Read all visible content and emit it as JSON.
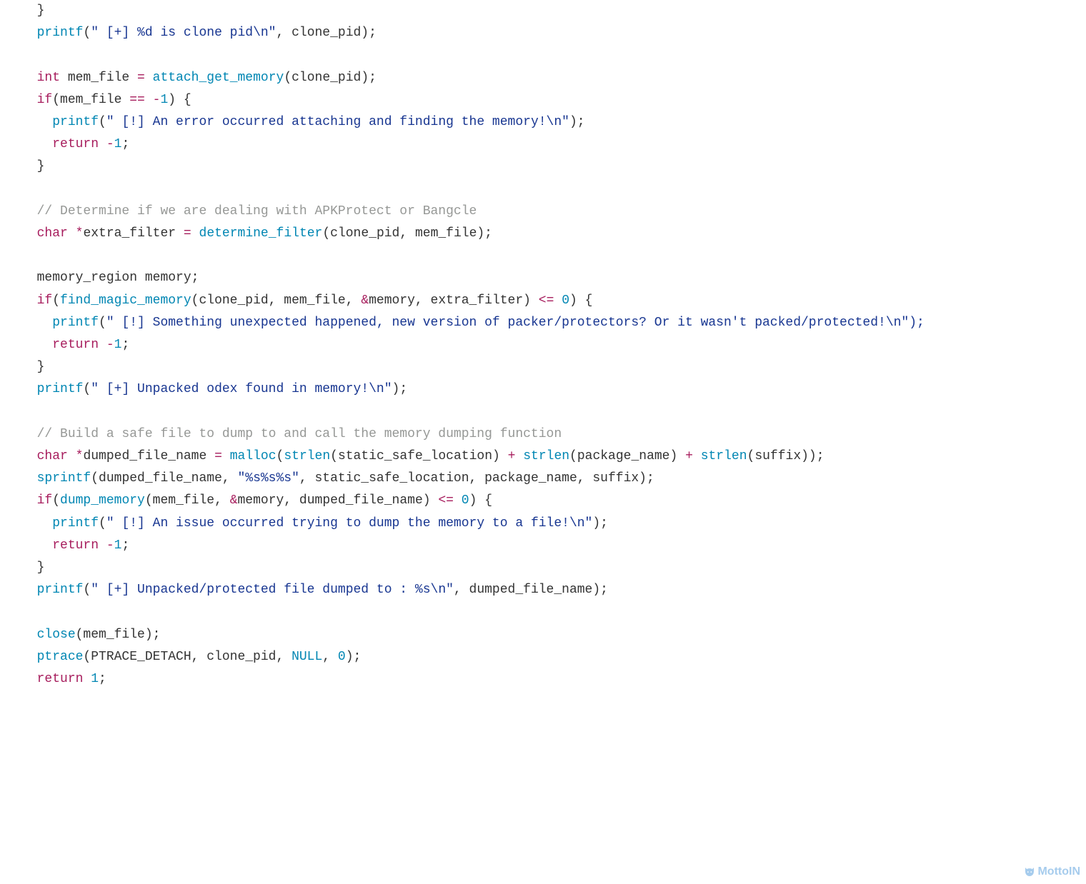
{
  "code": {
    "lines": [
      {
        "indent": 1,
        "tokens": [
          {
            "c": "id",
            "t": "}"
          }
        ]
      },
      {
        "indent": 1,
        "tokens": [
          {
            "c": "fn",
            "t": "printf"
          },
          {
            "c": "id",
            "t": "("
          },
          {
            "c": "str",
            "t": "\" [+] %d is clone pid\\n\""
          },
          {
            "c": "id",
            "t": ", clone_pid);"
          }
        ]
      },
      {
        "indent": 0,
        "tokens": []
      },
      {
        "indent": 1,
        "tokens": [
          {
            "c": "kw",
            "t": "int"
          },
          {
            "c": "id",
            "t": " mem_file "
          },
          {
            "c": "op",
            "t": "="
          },
          {
            "c": "id",
            "t": " "
          },
          {
            "c": "fn",
            "t": "attach_get_memory"
          },
          {
            "c": "id",
            "t": "(clone_pid);"
          }
        ]
      },
      {
        "indent": 1,
        "tokens": [
          {
            "c": "kw",
            "t": "if"
          },
          {
            "c": "id",
            "t": "(mem_file "
          },
          {
            "c": "op",
            "t": "=="
          },
          {
            "c": "id",
            "t": " "
          },
          {
            "c": "neg",
            "t": "-"
          },
          {
            "c": "num",
            "t": "1"
          },
          {
            "c": "id",
            "t": ") {"
          }
        ]
      },
      {
        "indent": 2,
        "tokens": [
          {
            "c": "fn",
            "t": "printf"
          },
          {
            "c": "id",
            "t": "("
          },
          {
            "c": "str",
            "t": "\" [!] An error occurred attaching and finding the memory!\\n\""
          },
          {
            "c": "id",
            "t": ");"
          }
        ]
      },
      {
        "indent": 2,
        "tokens": [
          {
            "c": "kw",
            "t": "return"
          },
          {
            "c": "id",
            "t": " "
          },
          {
            "c": "neg",
            "t": "-"
          },
          {
            "c": "num",
            "t": "1"
          },
          {
            "c": "id",
            "t": ";"
          }
        ]
      },
      {
        "indent": 1,
        "tokens": [
          {
            "c": "id",
            "t": "}"
          }
        ]
      },
      {
        "indent": 0,
        "tokens": []
      },
      {
        "indent": 1,
        "tokens": [
          {
            "c": "cmt",
            "t": "// Determine if we are dealing with APKProtect or Bangcle"
          }
        ]
      },
      {
        "indent": 1,
        "tokens": [
          {
            "c": "kw",
            "t": "char"
          },
          {
            "c": "id",
            "t": " "
          },
          {
            "c": "op",
            "t": "*"
          },
          {
            "c": "id",
            "t": "extra_filter "
          },
          {
            "c": "op",
            "t": "="
          },
          {
            "c": "id",
            "t": " "
          },
          {
            "c": "fn",
            "t": "determine_filter"
          },
          {
            "c": "id",
            "t": "(clone_pid, mem_file);"
          }
        ]
      },
      {
        "indent": 0,
        "tokens": []
      },
      {
        "indent": 1,
        "tokens": [
          {
            "c": "id",
            "t": "memory_region memory;"
          }
        ]
      },
      {
        "indent": 1,
        "tokens": [
          {
            "c": "kw",
            "t": "if"
          },
          {
            "c": "id",
            "t": "("
          },
          {
            "c": "fn",
            "t": "find_magic_memory"
          },
          {
            "c": "id",
            "t": "(clone_pid, mem_file, "
          },
          {
            "c": "op",
            "t": "&"
          },
          {
            "c": "id",
            "t": "memory, extra_filter) "
          },
          {
            "c": "op",
            "t": "<="
          },
          {
            "c": "id",
            "t": " "
          },
          {
            "c": "num",
            "t": "0"
          },
          {
            "c": "id",
            "t": ") {"
          }
        ]
      },
      {
        "indent": 2,
        "tokens": [
          {
            "c": "fn",
            "t": "printf"
          },
          {
            "c": "id",
            "t": "("
          },
          {
            "c": "str",
            "t": "\" [!] Something unexpected happened, new version of packer/protectors? Or it wasn't packed/protected!\\n\");"
          }
        ]
      },
      {
        "indent": 2,
        "tokens": [
          {
            "c": "kw",
            "t": "return"
          },
          {
            "c": "id",
            "t": " "
          },
          {
            "c": "neg",
            "t": "-"
          },
          {
            "c": "num",
            "t": "1"
          },
          {
            "c": "id",
            "t": ";"
          }
        ]
      },
      {
        "indent": 1,
        "tokens": [
          {
            "c": "id",
            "t": "}"
          }
        ]
      },
      {
        "indent": 1,
        "tokens": [
          {
            "c": "fn",
            "t": "printf"
          },
          {
            "c": "id",
            "t": "("
          },
          {
            "c": "str",
            "t": "\" [+] Unpacked odex found in memory!\\n\""
          },
          {
            "c": "id",
            "t": ");"
          }
        ]
      },
      {
        "indent": 0,
        "tokens": []
      },
      {
        "indent": 1,
        "tokens": [
          {
            "c": "cmt",
            "t": "// Build a safe file to dump to and call the memory dumping function"
          }
        ]
      },
      {
        "indent": 1,
        "tokens": [
          {
            "c": "kw",
            "t": "char"
          },
          {
            "c": "id",
            "t": " "
          },
          {
            "c": "op",
            "t": "*"
          },
          {
            "c": "id",
            "t": "dumped_file_name "
          },
          {
            "c": "op",
            "t": "="
          },
          {
            "c": "id",
            "t": " "
          },
          {
            "c": "fn",
            "t": "malloc"
          },
          {
            "c": "id",
            "t": "("
          },
          {
            "c": "fn",
            "t": "strlen"
          },
          {
            "c": "id",
            "t": "(static_safe_location) "
          },
          {
            "c": "op",
            "t": "+"
          },
          {
            "c": "id",
            "t": " "
          },
          {
            "c": "fn",
            "t": "strlen"
          },
          {
            "c": "id",
            "t": "(package_name) "
          },
          {
            "c": "op",
            "t": "+"
          },
          {
            "c": "id",
            "t": " "
          },
          {
            "c": "fn",
            "t": "strlen"
          },
          {
            "c": "id",
            "t": "(suffix));"
          }
        ]
      },
      {
        "indent": 1,
        "tokens": [
          {
            "c": "fn",
            "t": "sprintf"
          },
          {
            "c": "id",
            "t": "(dumped_file_name, "
          },
          {
            "c": "str",
            "t": "\"%s%s%s\""
          },
          {
            "c": "id",
            "t": ", static_safe_location, package_name, suffix);"
          }
        ]
      },
      {
        "indent": 1,
        "tokens": [
          {
            "c": "kw",
            "t": "if"
          },
          {
            "c": "id",
            "t": "("
          },
          {
            "c": "fn",
            "t": "dump_memory"
          },
          {
            "c": "id",
            "t": "(mem_file, "
          },
          {
            "c": "op",
            "t": "&"
          },
          {
            "c": "id",
            "t": "memory, dumped_file_name) "
          },
          {
            "c": "op",
            "t": "<="
          },
          {
            "c": "id",
            "t": " "
          },
          {
            "c": "num",
            "t": "0"
          },
          {
            "c": "id",
            "t": ") {"
          }
        ]
      },
      {
        "indent": 2,
        "tokens": [
          {
            "c": "fn",
            "t": "printf"
          },
          {
            "c": "id",
            "t": "("
          },
          {
            "c": "str",
            "t": "\" [!] An issue occurred trying to dump the memory to a file!\\n\""
          },
          {
            "c": "id",
            "t": ");"
          }
        ]
      },
      {
        "indent": 2,
        "tokens": [
          {
            "c": "kw",
            "t": "return"
          },
          {
            "c": "id",
            "t": " "
          },
          {
            "c": "neg",
            "t": "-"
          },
          {
            "c": "num",
            "t": "1"
          },
          {
            "c": "id",
            "t": ";"
          }
        ]
      },
      {
        "indent": 1,
        "tokens": [
          {
            "c": "id",
            "t": "}"
          }
        ]
      },
      {
        "indent": 1,
        "tokens": [
          {
            "c": "fn",
            "t": "printf"
          },
          {
            "c": "id",
            "t": "("
          },
          {
            "c": "str",
            "t": "\" [+] Unpacked/protected file dumped to : %s\\n\""
          },
          {
            "c": "id",
            "t": ", dumped_file_name);"
          }
        ]
      },
      {
        "indent": 0,
        "tokens": []
      },
      {
        "indent": 1,
        "tokens": [
          {
            "c": "fn",
            "t": "close"
          },
          {
            "c": "id",
            "t": "(mem_file);"
          }
        ]
      },
      {
        "indent": 1,
        "tokens": [
          {
            "c": "fn",
            "t": "ptrace"
          },
          {
            "c": "id",
            "t": "(PTRACE_DETACH, clone_pid, "
          },
          {
            "c": "num",
            "t": "NULL"
          },
          {
            "c": "id",
            "t": ", "
          },
          {
            "c": "num",
            "t": "0"
          },
          {
            "c": "id",
            "t": ");"
          }
        ]
      },
      {
        "indent": 1,
        "tokens": [
          {
            "c": "kw",
            "t": "return"
          },
          {
            "c": "id",
            "t": " "
          },
          {
            "c": "num",
            "t": "1"
          },
          {
            "c": "id",
            "t": ";"
          }
        ]
      }
    ]
  },
  "watermark": {
    "label": "MottoIN"
  }
}
